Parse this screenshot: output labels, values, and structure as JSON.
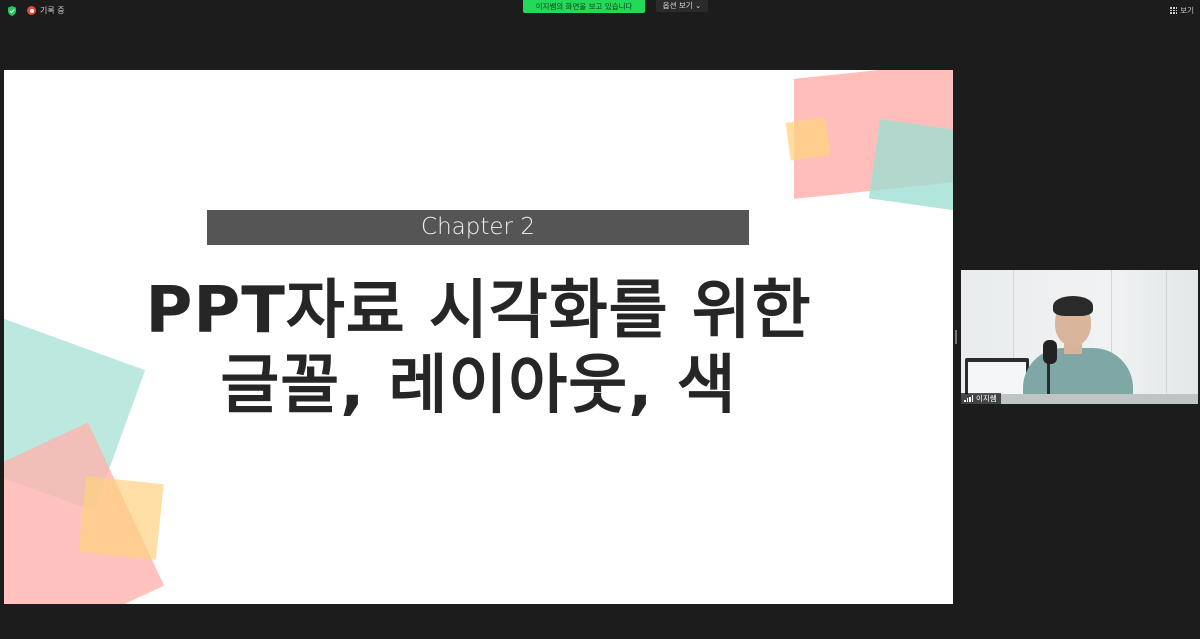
{
  "topbar": {
    "recording_label": "기록 중",
    "share_banner": "이지쌤의 화면을 보고 있습니다",
    "view_options_label": "옵션 보기 ⌄",
    "view_toggle_label": "보기"
  },
  "slide": {
    "chapter": "Chapter 2",
    "title_line1": "PPT자료 시각화를 위한",
    "title_line2": "글꼴, 레이아웃, 색"
  },
  "video_tile": {
    "participant_name": "이지쌤"
  },
  "colors": {
    "share_green": "#23d959",
    "record_red": "#e8453c",
    "chapter_bar": "#555555",
    "title_text": "#262626",
    "shape_pink": "#ffb3ae",
    "shape_teal": "#9fded3",
    "shape_yellow": "#ffd27f"
  },
  "icons": {
    "security": "shield-check-icon",
    "recording": "record-icon",
    "view": "grid-view-icon",
    "connection": "signal-bars-icon"
  }
}
